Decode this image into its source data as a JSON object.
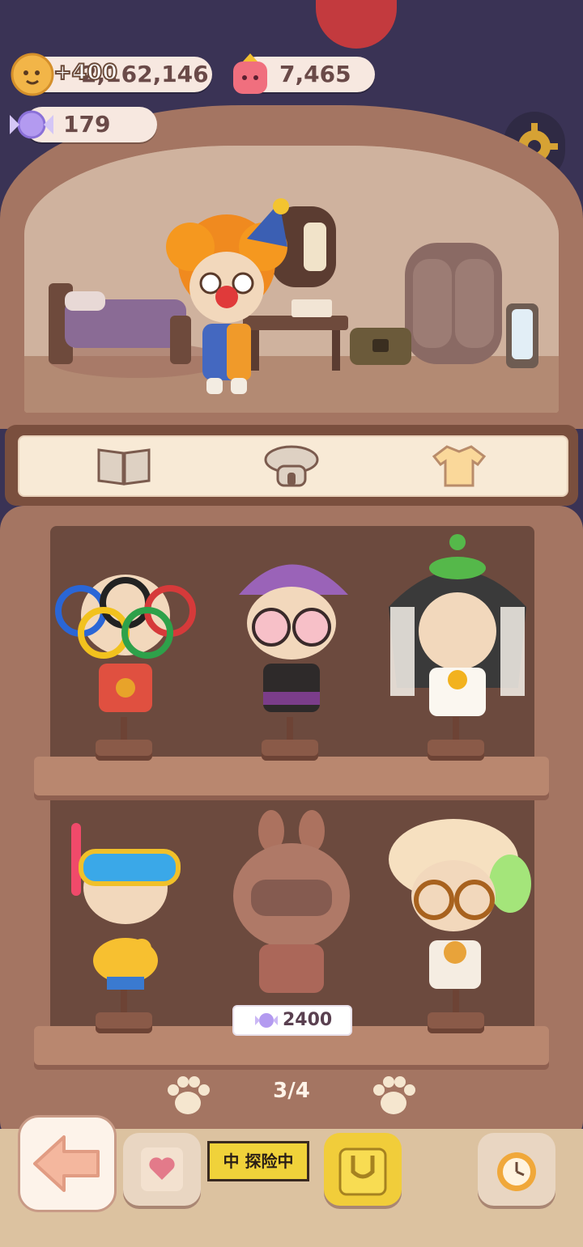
{
  "currencies": {
    "coins": {
      "value": "2,162,146",
      "icon": "cookie-coin-icon"
    },
    "coin_gain": "+400",
    "gems": {
      "value": "7,465",
      "icon": "pink-jelly-icon"
    },
    "candy": {
      "value": "179",
      "icon": "candy-icon"
    }
  },
  "tabs": [
    {
      "icon": "book-icon"
    },
    {
      "icon": "mushroom-house-icon"
    },
    {
      "icon": "shirt-icon"
    }
  ],
  "outfits": [
    {
      "icon": "olympic-rings-outfit"
    },
    {
      "icon": "purple-beanie-glasses-outfit"
    },
    {
      "icon": "snake-headdress-outfit"
    },
    {
      "icon": "snorkel-duck-float-outfit"
    },
    {
      "icon": "astronaut-helmet-outfit",
      "price": "2400",
      "price_icon": "candy-icon",
      "locked": true
    },
    {
      "icon": "cream-hat-glasses-outfit"
    }
  ],
  "pager": {
    "page": "3/4"
  },
  "explore_banner": "中 探险中",
  "colors": {
    "wood": "#a47562",
    "dark_wood": "#6c4a3e",
    "cream": "#f8ead6",
    "bg": "#3a3355"
  }
}
